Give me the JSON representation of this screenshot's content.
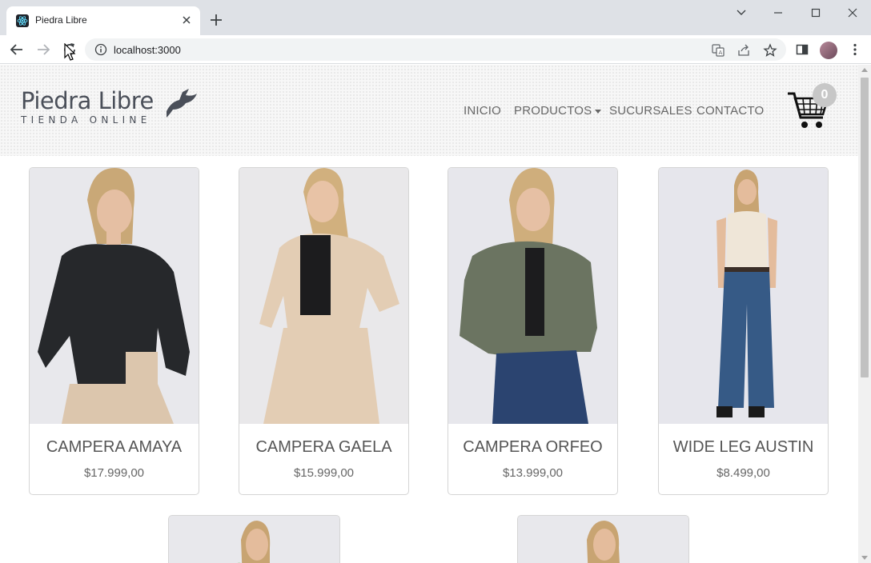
{
  "browser": {
    "tab_title": "Piedra Libre",
    "url": "localhost:3000"
  },
  "header": {
    "brand": "Piedra Libre",
    "tagline": "TIENDA ONLINE",
    "nav": [
      {
        "label": "INICIO"
      },
      {
        "label": "PRODUCTOS"
      },
      {
        "label": "SUCURSALES"
      },
      {
        "label": "CONTACTO"
      }
    ],
    "cart_count": "0"
  },
  "products": [
    {
      "name": "CAMPERA AMAYA",
      "price": "$17.999,00",
      "garment_color": "#26282b",
      "pants_color": "#dcc6ad"
    },
    {
      "name": "CAMPERA GAELA",
      "price": "$15.999,00",
      "garment_color": "#e3cdb4",
      "pants_color": "#e3cdb4"
    },
    {
      "name": "CAMPERA ORFEO",
      "price": "$13.999,00",
      "garment_color": "#6b7461",
      "pants_color": "#2b4470"
    },
    {
      "name": "WIDE LEG AUSTIN",
      "price": "$8.499,00",
      "garment_color": "#efe6d8",
      "pants_color": "#365a86"
    }
  ],
  "colors": {
    "text": "#555555",
    "brand": "#4a4f59",
    "badge": "#c7c7c7"
  }
}
